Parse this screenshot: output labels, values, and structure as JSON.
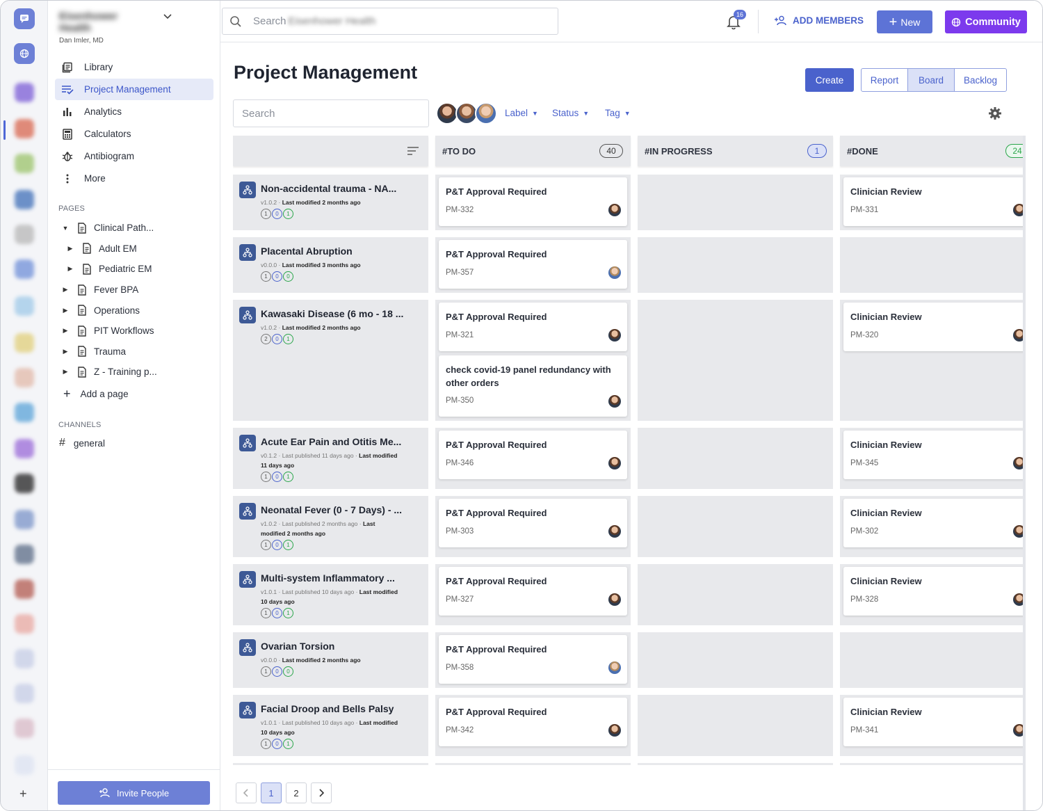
{
  "org": {
    "name": "Eisenhower Health",
    "user": "Dan Imler, MD"
  },
  "search": {
    "placeholder_prefix": "Search",
    "placeholder_org": "Eisenhower Health"
  },
  "notifications": {
    "count": "16"
  },
  "header": {
    "add_members": "ADD MEMBERS",
    "new_label": "New",
    "community_label": "Community"
  },
  "sidebar": {
    "items": [
      {
        "label": "Library",
        "icon": "library-icon"
      },
      {
        "label": "Project Management",
        "icon": "project-management-icon"
      },
      {
        "label": "Analytics",
        "icon": "analytics-icon"
      },
      {
        "label": "Calculators",
        "icon": "calculator-icon"
      },
      {
        "label": "Antibiogram",
        "icon": "antibiogram-icon"
      },
      {
        "label": "More",
        "icon": "more-icon"
      }
    ],
    "pages_label": "PAGES",
    "pages": [
      {
        "label": "Clinical Path..."
      },
      {
        "label": "Adult EM"
      },
      {
        "label": "Pediatric EM"
      },
      {
        "label": "Fever BPA"
      },
      {
        "label": "Operations"
      },
      {
        "label": "PIT Workflows"
      },
      {
        "label": "Trauma"
      },
      {
        "label": "Z - Training p..."
      }
    ],
    "add_page": "Add a page",
    "channels_label": "CHANNELS",
    "channel": "general",
    "invite": "Invite People"
  },
  "main": {
    "title": "Project Management",
    "create": "Create",
    "views": [
      "Report",
      "Board",
      "Backlog"
    ],
    "board_search": "Search",
    "filters": [
      "Label",
      "Status",
      "Tag"
    ]
  },
  "columns": [
    {
      "label": "#TO DO",
      "count": "40"
    },
    {
      "label": "#IN PROGRESS",
      "count": "1"
    },
    {
      "label": "#DONE",
      "count": "24"
    }
  ],
  "rows": [
    {
      "title": "Non-accidental trauma - NA...",
      "meta_a": "v1.0.2 · ",
      "meta_b": "Last modified 2 months ago",
      "pills": [
        "1",
        "0",
        "1"
      ],
      "todo": [
        {
          "title": "P&T Approval Required",
          "id": "PM-332"
        }
      ],
      "done": [
        {
          "title": "Clinician Review",
          "id": "PM-331"
        }
      ]
    },
    {
      "title": "Placental Abruption",
      "meta_a": "v0.0.0 · ",
      "meta_b": "Last modified 3 months ago",
      "pills": [
        "1",
        "0",
        "0"
      ],
      "todo": [
        {
          "title": "P&T Approval Required",
          "id": "PM-357"
        }
      ],
      "done": []
    },
    {
      "title": "Kawasaki Disease (6 mo - 18 ...",
      "meta_a": "v1.0.2 · ",
      "meta_b": "Last modified 2 months ago",
      "pills": [
        "2",
        "0",
        "1"
      ],
      "todo": [
        {
          "title": "P&T Approval Required",
          "id": "PM-321"
        },
        {
          "title": "check covid-19 panel redundancy with other orders",
          "id": "PM-350"
        }
      ],
      "done": [
        {
          "title": "Clinician Review",
          "id": "PM-320"
        }
      ]
    },
    {
      "title": "Acute Ear Pain and Otitis Me...",
      "meta_a": "v0.1.2 · Last published 11 days ago · ",
      "meta_b": "Last modified 11 days ago",
      "pills": [
        "1",
        "0",
        "1"
      ],
      "todo": [
        {
          "title": "P&T Approval Required",
          "id": "PM-346"
        }
      ],
      "done": [
        {
          "title": "Clinician Review",
          "id": "PM-345"
        }
      ]
    },
    {
      "title": "Neonatal Fever (0 - 7 Days) - ...",
      "meta_a": "v1.0.2 · Last published 2 months ago · ",
      "meta_b": "Last modified 2 months ago",
      "pills": [
        "1",
        "0",
        "1"
      ],
      "todo": [
        {
          "title": "P&T Approval Required",
          "id": "PM-303"
        }
      ],
      "done": [
        {
          "title": "Clinician Review",
          "id": "PM-302"
        }
      ]
    },
    {
      "title": "Multi-system Inflammatory ...",
      "meta_a": "v1.0.1 · Last published 10 days ago · ",
      "meta_b": "Last modified 10 days ago",
      "pills": [
        "1",
        "0",
        "1"
      ],
      "todo": [
        {
          "title": "P&T Approval Required",
          "id": "PM-327"
        }
      ],
      "done": [
        {
          "title": "Clinician Review",
          "id": "PM-328"
        }
      ]
    },
    {
      "title": "Ovarian Torsion",
      "meta_a": "v0.0.0 · ",
      "meta_b": "Last modified 2 months ago",
      "pills": [
        "1",
        "0",
        "0"
      ],
      "todo": [
        {
          "title": "P&T Approval Required",
          "id": "PM-358"
        }
      ],
      "done": []
    },
    {
      "title": "Facial Droop and Bells Palsy",
      "meta_a": "v1.0.1 · Last published 10 days ago · ",
      "meta_b": "Last modified 10 days ago",
      "pills": [
        "1",
        "0",
        "1"
      ],
      "todo": [
        {
          "title": "P&T Approval Required",
          "id": "PM-342"
        }
      ],
      "done": [
        {
          "title": "Clinician Review",
          "id": "PM-341"
        }
      ]
    }
  ],
  "pagination": {
    "pages": [
      "1",
      "2"
    ],
    "current": "1"
  },
  "colors": {
    "accent": "#4a62cc",
    "community": "#7c3aed",
    "column_bg": "#e8e9ec"
  }
}
